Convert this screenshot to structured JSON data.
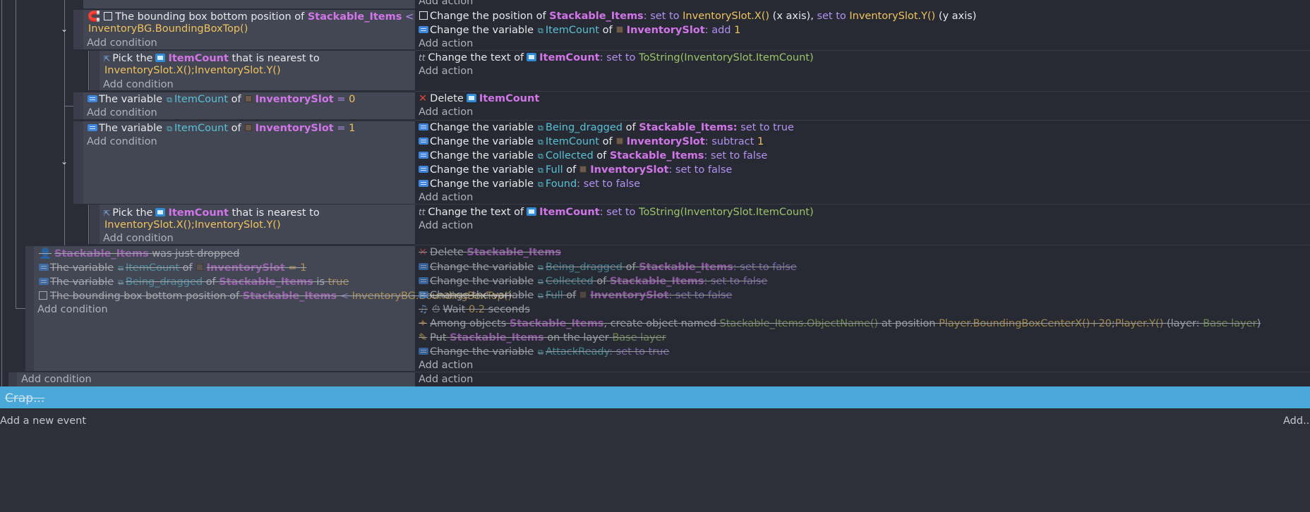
{
  "labels": {
    "add_action": "Add action",
    "add_condition": "Add condition",
    "group_title": "Crap...",
    "add_new_event": "Add a new event",
    "add_menu": "Add..."
  },
  "icons": {
    "expand": "chevron-down-icon",
    "variable": "variable-icon",
    "object": "object-icon",
    "checkbox": "checkbox-icon",
    "delete": "x-icon",
    "pick": "pick-icon",
    "text": "text-icon",
    "wait": "clock-icon",
    "create": "create-object-icon",
    "layer": "pencil-icon",
    "drop": "mouse-drop-icon"
  },
  "colors": {
    "object_name": "#d175e8",
    "value": "#f0c35c",
    "operation": "#b391f1",
    "variable_name": "#59c1d5",
    "expression": "#9bc469",
    "delete_mark": "#e0453a",
    "group_bar": "#4aa9d9"
  },
  "ev1": {
    "c1_a": "The bounding box bottom position of",
    "c1_obj": "Stackable_Items",
    "c1_op": "<",
    "c1_val": "InventoryBG.BoundingBoxTop()",
    "a1_a": "Change the position of",
    "a1_obj": "Stackable_Items",
    "a1_b": ": set to",
    "a1_val1": "InventorySlot.X()",
    "a1_c": "(x axis),",
    "a1_d": "set to",
    "a1_val2": "InventorySlot.Y()",
    "a1_e": "(y axis)",
    "a2_a": "Change the variable",
    "a2_var": "ItemCount",
    "a2_of": "of",
    "a2_obj": "InventorySlot",
    "a2_op": ": add",
    "a2_val": "1"
  },
  "sub1": {
    "c_a": "Pick the",
    "c_obj": "ItemCount",
    "c_b": "that is nearest to",
    "c_val": "InventorySlot.X();InventorySlot.Y()",
    "a_a": "Change the text of",
    "a_obj": "ItemCount",
    "a_op": ": set to",
    "a_val": "ToString(InventorySlot.ItemCount)"
  },
  "ev2": {
    "c_a": "The variable",
    "c_var": "ItemCount",
    "c_of": "of",
    "c_obj": "InventorySlot",
    "c_op": "=",
    "c_val": "0",
    "a_a": "Delete",
    "a_obj": "ItemCount"
  },
  "ev3": {
    "c_a": "The variable",
    "c_var": "ItemCount",
    "c_of": "of",
    "c_obj": "InventorySlot",
    "c_op": "=",
    "c_val": "1",
    "a1_a": "Change the variable",
    "a1_var": "Being_dragged",
    "a1_of": "of",
    "a1_obj": "Stackable_Items:",
    "a1_op": "set to true",
    "a2_a": "Change the variable",
    "a2_var": "ItemCount",
    "a2_of": "of",
    "a2_obj": "InventorySlot",
    "a2_op": ": subtract",
    "a2_val": "1",
    "a3_a": "Change the variable",
    "a3_var": "Collected",
    "a3_of": "of",
    "a3_obj": "Stackable_Items",
    "a3_op": ": set to false",
    "a4_a": "Change the variable",
    "a4_var": "Full",
    "a4_of": "of",
    "a4_obj": "InventorySlot",
    "a4_op": ": set to false",
    "a5_a": "Change the variable",
    "a5_var": "Found",
    "a5_op": ": set to false"
  },
  "sub2": {
    "c_a": "Pick the",
    "c_obj": "ItemCount",
    "c_b": "that is nearest to",
    "c_val": "InventorySlot.X();InventorySlot.Y()",
    "a_a": "Change the text of",
    "a_obj": "ItemCount",
    "a_op": ": set to",
    "a_val": "ToString(InventorySlot.ItemCount)"
  },
  "ev4": {
    "c1_obj": "Stackable_Items",
    "c1_b": "was just dropped",
    "c2_a": "The variable",
    "c2_var": "ItemCount",
    "c2_of": "of",
    "c2_obj": "InventorySlot",
    "c2_op": "= 1",
    "c3_a": "The variable",
    "c3_var": "Being_dragged",
    "c3_of": "of",
    "c3_obj": "Stackable_Items",
    "c3_b": "is",
    "c3_val": "true",
    "c4_a": "The bounding box bottom position of",
    "c4_obj": "Stackable_Items",
    "c4_op": "<",
    "c4_val": "InventoryBG.BoundingBoxTop()",
    "a1_a": "Delete",
    "a1_obj": "Stackable_Items",
    "a2_a": "Change the variable",
    "a2_var": "Being_dragged",
    "a2_of": "of",
    "a2_obj": "Stackable_Items",
    "a2_op": ": set to false",
    "a3_a": "Change the variable",
    "a3_var": "Collected",
    "a3_of": "of",
    "a3_obj": "Stackable_Items",
    "a3_op": ": set to false",
    "a4_a": "Change the variable",
    "a4_var": "Full",
    "a4_of": "of",
    "a4_obj": "InventorySlot",
    "a4_op": ": set to false",
    "a5_a": "Wait",
    "a5_val": "0.2",
    "a5_b": "seconds",
    "a6_a": "Among objects",
    "a6_obj": "Stackable_Items",
    "a6_b": ", create object named",
    "a6_val1": "Stackable_Items.ObjectName()",
    "a6_c": "at position",
    "a6_val2": "Player.BoundingBoxCenterX()+20",
    "a6_sep": ";",
    "a6_val3": "Player.Y()",
    "a6_d": "(layer:",
    "a6_layer": "Base layer",
    "a6_e": ")",
    "a7_a": "Put",
    "a7_obj": "Stackable_Items",
    "a7_b": "on the layer",
    "a7_val": "Base layer",
    "a8_a": "Change the variable",
    "a8_var": "AttackReady",
    "a8_op": ": set to true"
  }
}
